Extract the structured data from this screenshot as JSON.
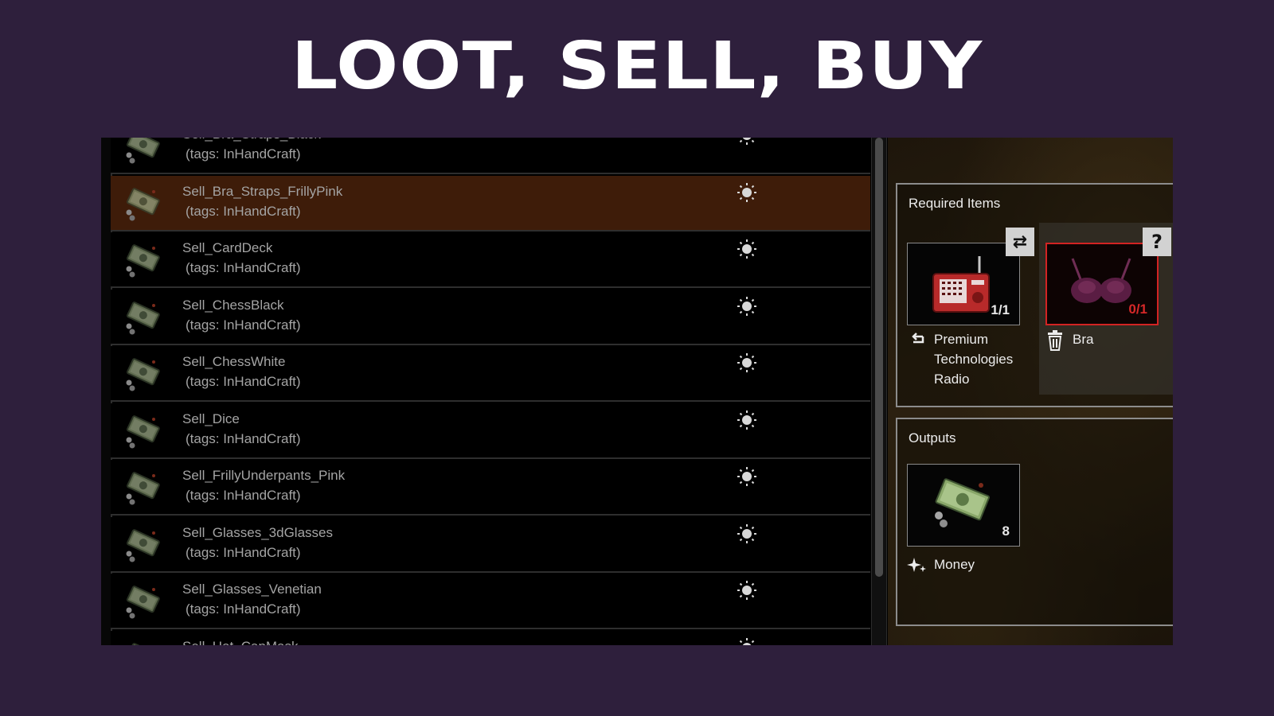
{
  "banner": {
    "title": "LOOT, SELL, BUY"
  },
  "recipes": [
    {
      "name": "Sell_Bra_Straps_Black",
      "tags": "(tags: InHandCraft)",
      "selected": false
    },
    {
      "name": "Sell_Bra_Straps_FrillyPink",
      "tags": "(tags: InHandCraft)",
      "selected": true
    },
    {
      "name": "Sell_CardDeck",
      "tags": "(tags: InHandCraft)",
      "selected": false
    },
    {
      "name": "Sell_ChessBlack",
      "tags": "(tags: InHandCraft)",
      "selected": false
    },
    {
      "name": "Sell_ChessWhite",
      "tags": "(tags: InHandCraft)",
      "selected": false
    },
    {
      "name": "Sell_Dice",
      "tags": "(tags: InHandCraft)",
      "selected": false
    },
    {
      "name": "Sell_FrillyUnderpants_Pink",
      "tags": "(tags: InHandCraft)",
      "selected": false
    },
    {
      "name": "Sell_Glasses_3dGlasses",
      "tags": "(tags: InHandCraft)",
      "selected": false
    },
    {
      "name": "Sell_Glasses_Venetian",
      "tags": "(tags: InHandCraft)",
      "selected": false
    },
    {
      "name": "Sell_Hat_CapMask",
      "tags": "",
      "selected": false
    }
  ],
  "required": {
    "title": "Required Items",
    "items": [
      {
        "count": "1/1",
        "label_lines": [
          "Premium",
          "Technologies",
          "Radio"
        ],
        "icon": "radio-icon",
        "status": "available"
      },
      {
        "count": "0/1",
        "label_lines": [
          "Bra"
        ],
        "icon": "bra-icon",
        "status": "missing"
      }
    ],
    "swap_button": "⇄",
    "help_button": "?"
  },
  "outputs": {
    "title": "Outputs",
    "item": {
      "count": "8",
      "label": "Money",
      "icon": "money-icon"
    }
  },
  "colors": {
    "background": "#2e1f3c",
    "selected_row": "#3e1c09",
    "missing_border": "#d22323"
  }
}
